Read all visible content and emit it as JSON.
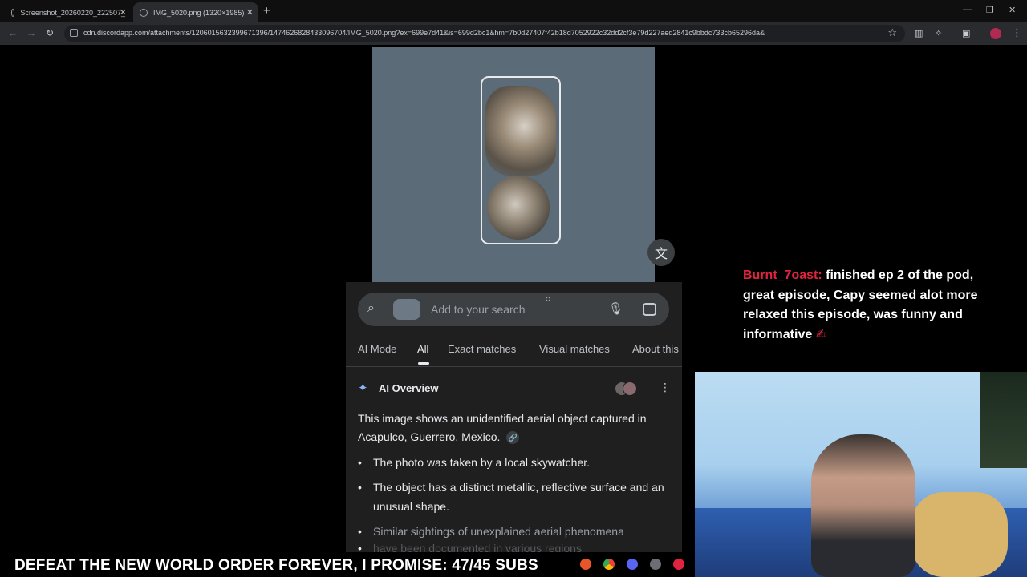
{
  "browser": {
    "tabs": [
      {
        "title": "Screenshot_20260220_222507_"
      },
      {
        "title": "IMG_5020.png (1320×1985)"
      }
    ],
    "url": "cdn.discordapp.com/attachments/1206015632399671396/1474626828433096704/IMG_5020.png?ex=699e7d41&is=699d2bc1&hm=7b0d27407f42b18d7052922c32dd2cf3e79d227aed2841c9bbdc733cb65296da&"
  },
  "lens": {
    "search_placeholder": "Add to your search",
    "tabs": [
      "AI Mode",
      "All",
      "Exact matches",
      "Visual matches",
      "About this"
    ],
    "active_tab": "All",
    "ai_overview": {
      "title": "AI Overview",
      "summary": "This image shows an unidentified aerial object captured in Acapulco, Guerrero, Mexico.",
      "bullets": [
        "The photo was taken by a local skywatcher.",
        "The object has a distinct metallic, reflective surface and an unusual shape.",
        "Similar sightings of unexplained aerial phenomena",
        "have been documented in various regions"
      ]
    }
  },
  "chat": {
    "username": "Burnt_7oast:",
    "message": "finished ep 2 of the pod, great episode, Capy seemed alot more relaxed this episode, was funny and informative"
  },
  "ticker": {
    "text": "DEFEAT THE NEW WORLD ORDER FOREVER, I PROMISE: 47/45 SUBS"
  },
  "icons": {
    "search": "search-icon",
    "mic": "microphone-icon",
    "lens": "lens-icon",
    "translate": "translate-icon",
    "spark": "sparkle-icon"
  }
}
